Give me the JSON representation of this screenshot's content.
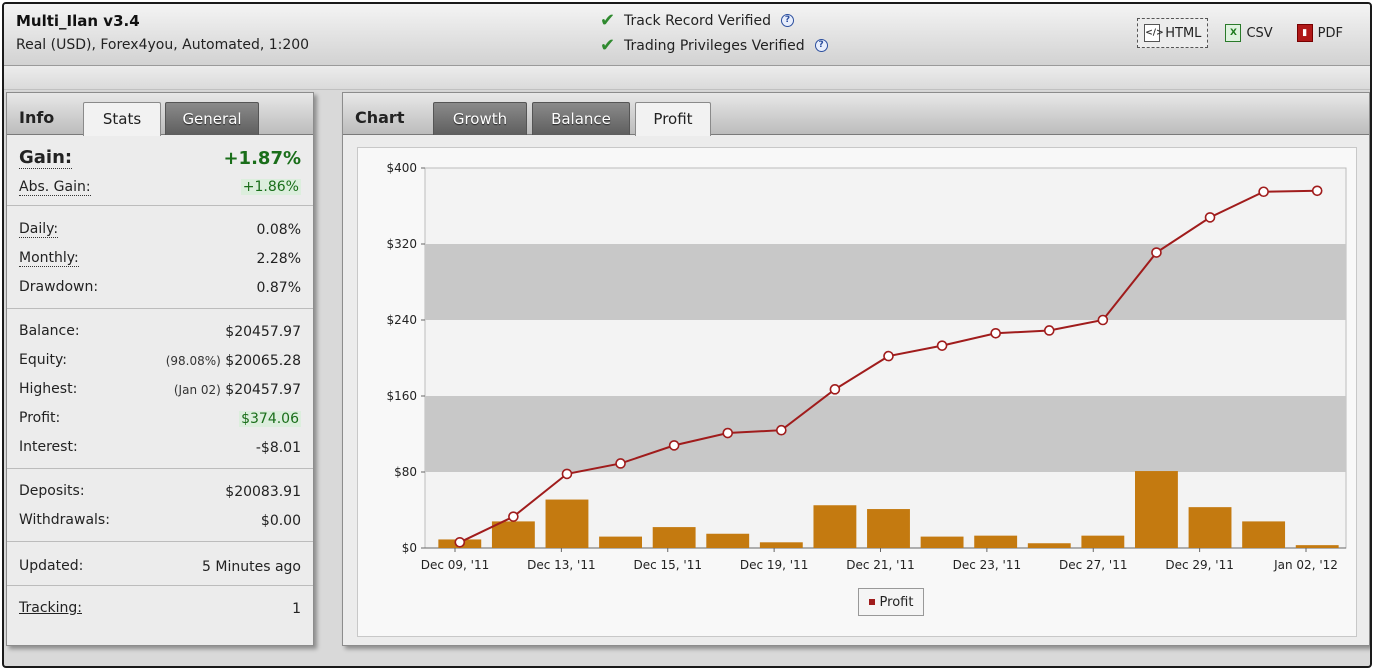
{
  "header": {
    "account_name": "Multi_Ilan v3.4",
    "account_sub": "Real (USD), Forex4you, Automated, 1:200",
    "verifications": [
      {
        "label": "Track Record Verified",
        "help": "?"
      },
      {
        "label": "Trading Privileges Verified",
        "help": "?"
      }
    ],
    "exports": [
      {
        "label": "HTML",
        "icon": "html-file-icon",
        "icon_text": "</>"
      },
      {
        "label": "CSV",
        "icon": "csv-file-icon",
        "icon_text": "X"
      },
      {
        "label": "PDF",
        "icon": "pdf-file-icon",
        "icon_text": "▮"
      }
    ],
    "check_glyph": "✔"
  },
  "left": {
    "title": "Info",
    "tabs": [
      "Stats",
      "General"
    ],
    "stats": {
      "gain_label": "Gain:",
      "gain": "+1.87%",
      "abs_gain_label": "Abs. Gain:",
      "abs_gain": "+1.86%",
      "daily_label": "Daily:",
      "daily": "0.08%",
      "monthly_label": "Monthly:",
      "monthly": "2.28%",
      "drawdown_label": "Drawdown:",
      "drawdown": "0.87%",
      "balance_label": "Balance:",
      "balance": "$20457.97",
      "equity_label": "Equity:",
      "equity_pct": "(98.08%)",
      "equity": "$20065.28",
      "highest_label": "Highest:",
      "highest_date": "(Jan 02)",
      "highest": "$20457.97",
      "profit_label": "Profit:",
      "profit": "$374.06",
      "interest_label": "Interest:",
      "interest": "-$8.01",
      "deposits_label": "Deposits:",
      "deposits": "$20083.91",
      "withdrawals_label": "Withdrawals:",
      "withdrawals": "$0.00",
      "updated_label": "Updated:",
      "updated": "5 Minutes ago",
      "tracking_label": "Tracking:",
      "tracking": "1"
    }
  },
  "right": {
    "title": "Chart",
    "tabs": [
      "Growth",
      "Balance",
      "Profit"
    ],
    "active_tab": "Profit"
  },
  "colors": {
    "bar": "#c47a10",
    "line": "#a01c1c",
    "band": "#c8c8c8",
    "green": "#1a6e1a"
  },
  "chart_data": {
    "type": "bar",
    "y_tick_labels": [
      "$0",
      "$80",
      "$160",
      "$240",
      "$320",
      "$400"
    ],
    "ylim": [
      0,
      400
    ],
    "y_ticks": [
      0,
      80,
      160,
      240,
      320,
      400
    ],
    "x_tick_labels": [
      "Dec 09, '11",
      "Dec 13, '11",
      "Dec 15, '11",
      "Dec 19, '11",
      "Dec 21, '11",
      "Dec 23, '11",
      "Dec 27, '11",
      "Dec 29, '11",
      "Jan 02, '12"
    ],
    "legend": [
      "Profit"
    ],
    "legend_placement": "bottom",
    "series": [
      {
        "name": "Profit",
        "type": "bar",
        "values": [
          9,
          28,
          51,
          12,
          22,
          15,
          6,
          45,
          41,
          12,
          13,
          5,
          13,
          81,
          43,
          28,
          3
        ]
      },
      {
        "name": "Profit",
        "type": "line",
        "values": [
          6,
          33,
          78,
          89,
          108,
          121,
          124,
          167,
          202,
          213,
          226,
          229,
          240,
          311,
          348,
          375,
          376
        ]
      }
    ]
  }
}
